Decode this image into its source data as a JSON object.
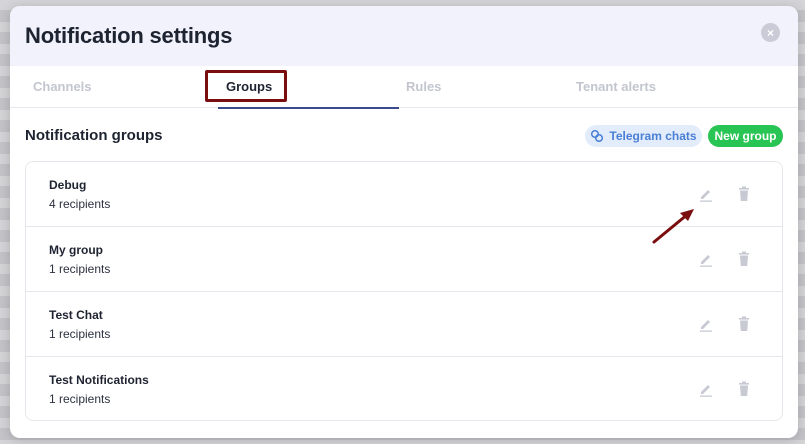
{
  "modal": {
    "title": "Notification settings",
    "close_symbol": "×"
  },
  "tabs": [
    {
      "label": "Channels",
      "active": false
    },
    {
      "label": "Groups",
      "active": true
    },
    {
      "label": "Rules",
      "active": false
    },
    {
      "label": "Tenant alerts",
      "active": false
    }
  ],
  "section": {
    "title": "Notification groups",
    "telegram_button": "Telegram chats",
    "new_group_button": "New group"
  },
  "groups": [
    {
      "name": "Debug",
      "recipients": "4 recipients"
    },
    {
      "name": "My group",
      "recipients": "1 recipients"
    },
    {
      "name": "Test Chat",
      "recipients": "1 recipients"
    },
    {
      "name": "Test Notifications",
      "recipients": "1 recipients"
    }
  ],
  "icons": {
    "edit": "pencil-icon",
    "delete": "trash-icon",
    "telegram": "link-icon",
    "close": "close-icon"
  },
  "colors": {
    "header_bg": "#f1f2fb",
    "accent_green": "#28c454",
    "telegram_bg": "#e3ecfb",
    "telegram_text": "#4a7fd6",
    "highlight": "#7a0d0d",
    "tab_underline": "#3a4a8a"
  }
}
